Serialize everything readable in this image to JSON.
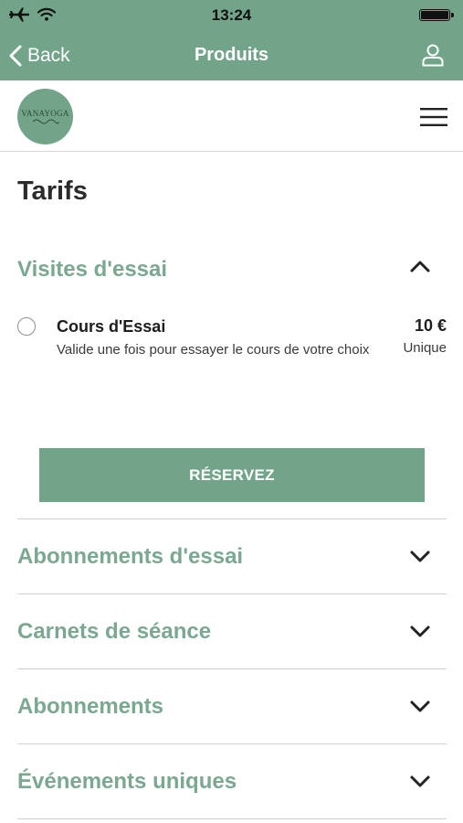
{
  "status_bar": {
    "time": "13:24"
  },
  "nav": {
    "back_label": "Back",
    "title": "Produits"
  },
  "header": {
    "logo_text": "VANAYOGA"
  },
  "page": {
    "title": "Tarifs"
  },
  "sections": [
    {
      "label": "Visites d'essai",
      "expanded": true
    },
    {
      "label": "Abonnements d'essai",
      "expanded": false
    },
    {
      "label": "Carnets de séance",
      "expanded": false
    },
    {
      "label": "Abonnements",
      "expanded": false
    },
    {
      "label": "Événements uniques",
      "expanded": false
    }
  ],
  "products": [
    {
      "name": "Cours d'Essai",
      "description": "Valide une fois pour essayer le cours de votre choix",
      "price": "10 €",
      "price_type": "Unique",
      "selected": false
    }
  ],
  "actions": {
    "reserve_label": "RÉSERVEZ"
  },
  "colors": {
    "brand": "#71a489",
    "section_text": "#7aa891"
  }
}
